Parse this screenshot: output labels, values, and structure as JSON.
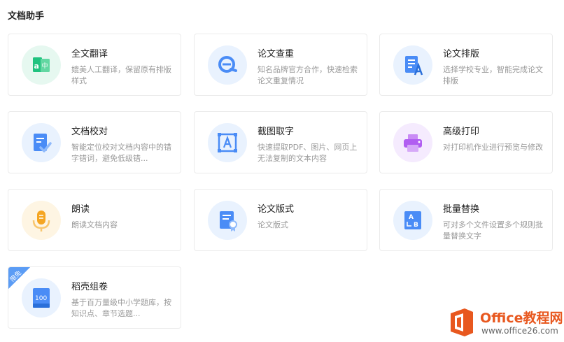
{
  "section": {
    "title": "文档助手"
  },
  "cards": [
    {
      "title": "全文翻译",
      "desc": "媲美人工翻译，保留原有排版样式",
      "icon": "translate-icon"
    },
    {
      "title": "论文查重",
      "desc": "知名品牌官方合作，快速检索论文重复情况",
      "icon": "plagiarism-check-icon"
    },
    {
      "title": "论文排版",
      "desc": "选择学校专业，智能完成论文排版",
      "icon": "paper-format-icon"
    },
    {
      "title": "文档校对",
      "desc": "智能定位校对文档内容中的错字错词，避免低级错...",
      "icon": "proofread-icon"
    },
    {
      "title": "截图取字",
      "desc": "快速提取PDF、图片、网页上无法复制的文本内容",
      "icon": "screenshot-ocr-icon"
    },
    {
      "title": "高级打印",
      "desc": "对打印机作业进行预览与修改",
      "icon": "printer-icon"
    },
    {
      "title": "朗读",
      "desc": "朗读文档内容",
      "icon": "microphone-icon"
    },
    {
      "title": "论文版式",
      "desc": "论文版式",
      "icon": "certificate-doc-icon"
    },
    {
      "title": "批量替换",
      "desc": "可对多个文件设置多个规则批量替换文字",
      "icon": "batch-replace-icon"
    },
    {
      "title": "稻壳组卷",
      "desc": "基于百万量级中小学题库，按知识点、章节选题...",
      "icon": "exam-paper-icon",
      "badge": "限免",
      "icon_text": "100"
    }
  ],
  "colors": {
    "translate": "#20c27f",
    "blue": "#4a8cf6",
    "purple": "#b15ef1",
    "orange": "#f5a623"
  },
  "watermark": {
    "brand": "Office教程网",
    "url": "www.office26.com"
  }
}
